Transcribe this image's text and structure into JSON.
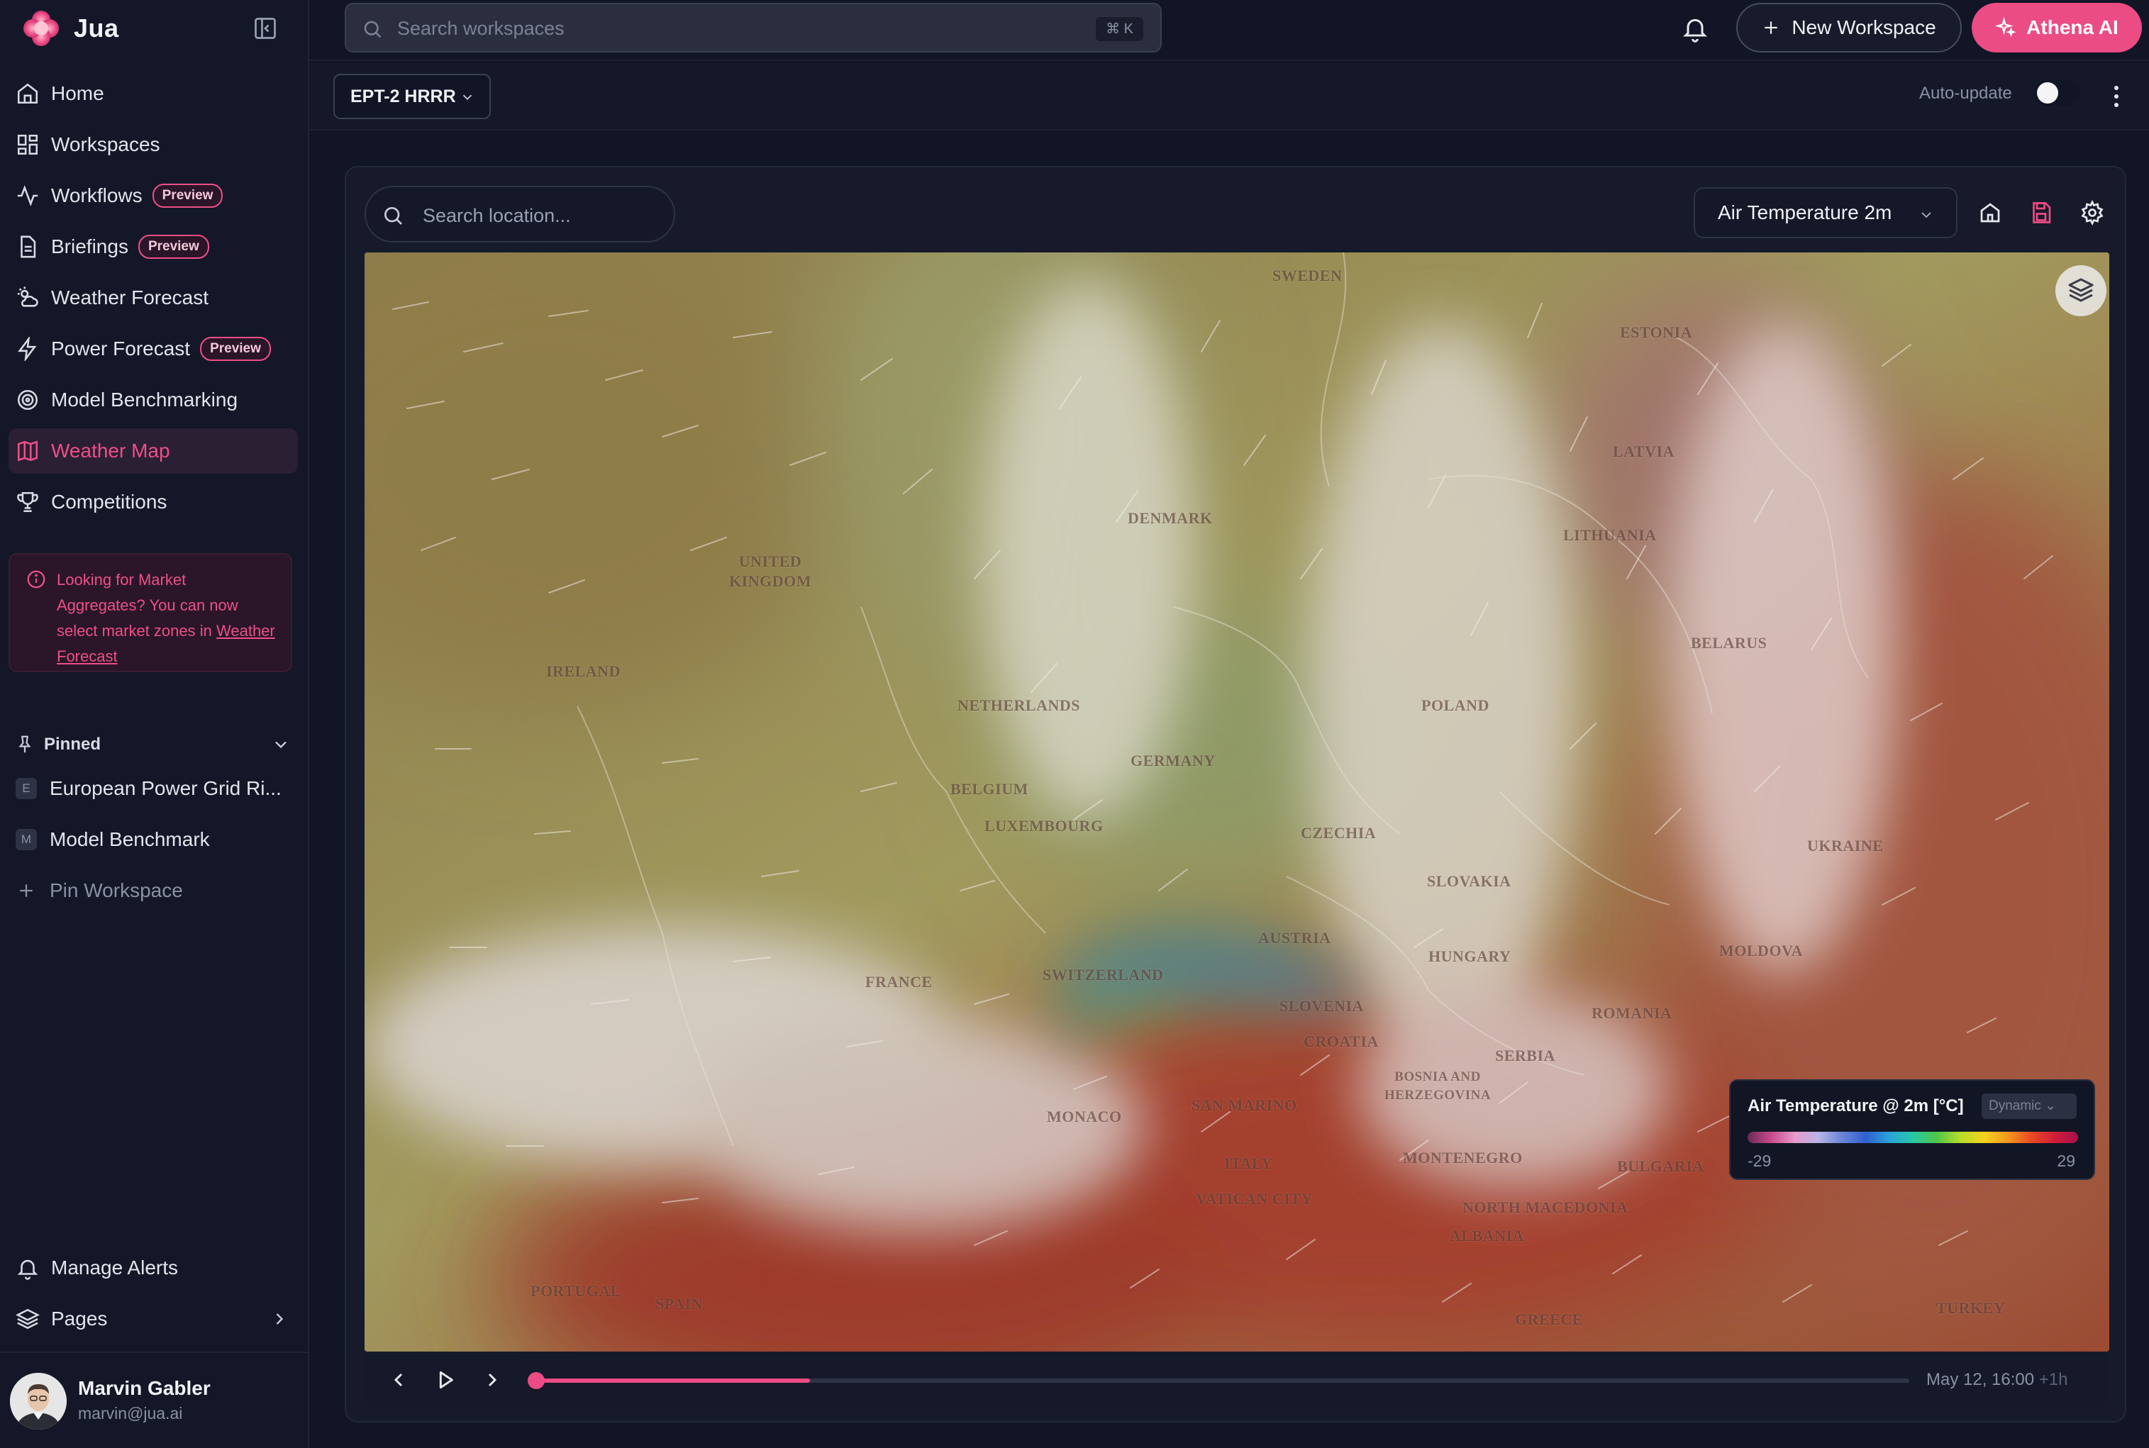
{
  "app": {
    "name": "Jua",
    "accent": "#ea4c83"
  },
  "sidebar": {
    "items": [
      {
        "label": "Home",
        "icon": "home-icon"
      },
      {
        "label": "Workspaces",
        "icon": "grid-icon"
      },
      {
        "label": "Workflows",
        "icon": "activity-icon",
        "badge": "Preview"
      },
      {
        "label": "Briefings",
        "icon": "document-icon",
        "badge": "Preview"
      },
      {
        "label": "Weather Forecast",
        "icon": "cloud-sun-icon"
      },
      {
        "label": "Power Forecast",
        "icon": "bolt-icon",
        "badge": "Preview"
      },
      {
        "label": "Model Benchmarking",
        "icon": "target-icon"
      },
      {
        "label": "Weather Map",
        "icon": "map-icon",
        "active": true
      },
      {
        "label": "Competitions",
        "icon": "trophy-icon"
      }
    ],
    "notice": {
      "text": "Looking for Market Aggregates? You can now select market zones in",
      "link": "Weather Forecast"
    },
    "pinned": {
      "title": "Pinned",
      "items": [
        {
          "letter": "E",
          "label": "European Power Grid Ri..."
        },
        {
          "letter": "M",
          "label": "Model Benchmark"
        }
      ],
      "add_label": "Pin Workspace"
    },
    "bottom": {
      "alerts": "Manage Alerts",
      "pages": "Pages"
    },
    "user": {
      "name": "Marvin Gabler",
      "email": "marvin@jua.ai"
    }
  },
  "header": {
    "search_placeholder": "Search workspaces",
    "shortcut": "⌘ K",
    "new_workspace": "New Workspace",
    "athena": "Athena AI"
  },
  "toolbar": {
    "model": "EPT-2 HRRR",
    "auto_update": "Auto-update",
    "auto_update_on": false
  },
  "map": {
    "location_placeholder": "Search location...",
    "variable": "Air Temperature 2m",
    "countries": [
      {
        "name": "SWEDEN"
      },
      {
        "name": "ESTONIA"
      },
      {
        "name": "LATVIA"
      },
      {
        "name": "LITHUANIA"
      },
      {
        "name": "DENMARK"
      },
      {
        "name": "UNITED KINGDOM"
      },
      {
        "name": "IRELAND"
      },
      {
        "name": "BELARUS"
      },
      {
        "name": "NETHERLANDS"
      },
      {
        "name": "POLAND"
      },
      {
        "name": "GERMANY"
      },
      {
        "name": "BELGIUM"
      },
      {
        "name": "LUXEMBOURG"
      },
      {
        "name": "CZECHIA"
      },
      {
        "name": "UKRAINE"
      },
      {
        "name": "SLOVAKIA"
      },
      {
        "name": "MOLDOVA"
      },
      {
        "name": "HUNGARY"
      },
      {
        "name": "AUSTRIA"
      },
      {
        "name": "SWITZERLAND"
      },
      {
        "name": "FRANCE"
      },
      {
        "name": "SLOVENIA"
      },
      {
        "name": "ROMANIA"
      },
      {
        "name": "CROATIA"
      },
      {
        "name": "BOSNIA AND HERZEGOVINA"
      },
      {
        "name": "SERBIA"
      },
      {
        "name": "MONACO"
      },
      {
        "name": "SAN MARINO"
      },
      {
        "name": "MONTENEGRO"
      },
      {
        "name": "BULGARIA"
      },
      {
        "name": "ITALY"
      },
      {
        "name": "VATICAN CITY"
      },
      {
        "name": "NORTH MACEDONIA"
      },
      {
        "name": "ALBANIA"
      },
      {
        "name": "PORTUGAL"
      },
      {
        "name": "SPAIN"
      },
      {
        "name": "GREECE"
      },
      {
        "name": "TURKEY"
      }
    ],
    "legend": {
      "title": "Air Temperature @ 2m [°C]",
      "mode": "Dynamic",
      "min": "-29",
      "max": "29"
    },
    "timeline": {
      "time": "May 12, 16:00",
      "step": "+1h",
      "progress": 0.2
    }
  }
}
